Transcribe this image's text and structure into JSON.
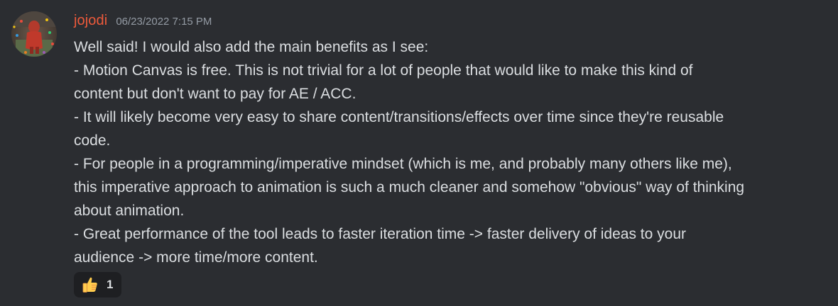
{
  "message": {
    "author": "jojodi",
    "author_color": "#ee5a3b",
    "timestamp": "06/23/2022 7:15 PM",
    "avatar_icon": "avatar-image",
    "lines": [
      "Well said! I would also add the main benefits as I see:",
      "- Motion Canvas is free. This is not trivial for a lot of people that would like to make this kind of",
      "content but don't want to pay for AE / ACC.",
      "- It will likely become very easy to share content/transitions/effects over time since they're reusable",
      "code.",
      "- For people in a programming/imperative mindset (which is me, and probably many others like me),",
      "this imperative approach to animation is such a much cleaner and somehow \"obvious\" way of thinking",
      "about animation.",
      "- Great performance of the tool leads to faster iteration time -> faster delivery of ideas to your",
      "audience -> more time/more content."
    ],
    "reactions": [
      {
        "emoji": "thumbs-up-icon",
        "count": "1"
      }
    ]
  },
  "colors": {
    "background": "#2b2d31",
    "text": "#dbdee1",
    "muted": "#949ba4",
    "reaction_bg": "#1e1f22"
  }
}
